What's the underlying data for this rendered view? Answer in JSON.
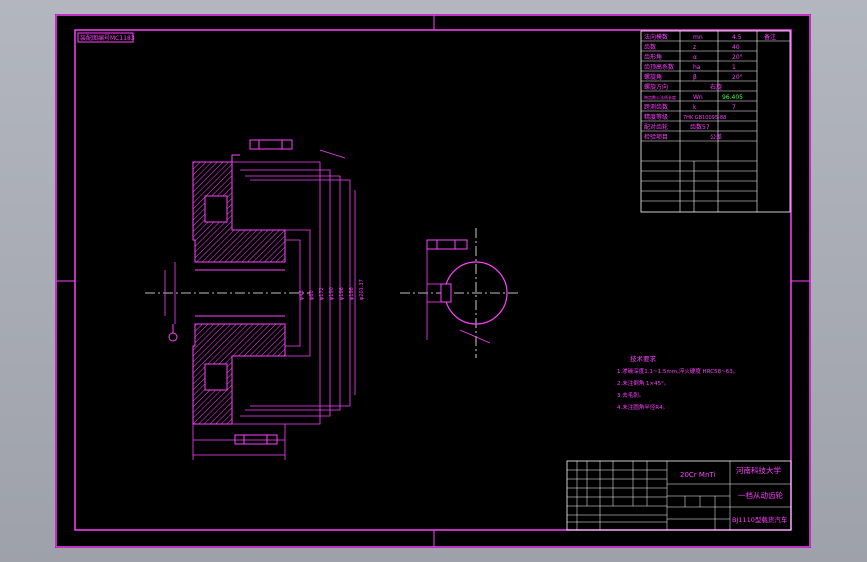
{
  "drawing": {
    "top_left_label": "装配图编号MC1183",
    "title_block": {
      "scale_code": "20Cr MnTi",
      "university": "河南科技大学",
      "part_name": "一档从动齿轮",
      "assembly_name": "BJ1110型载货汽车"
    },
    "tech_requirements": {
      "heading": "技术要求",
      "items": [
        "1.渗碳深度1.1~1.5mm,淬火硬度 HRC58~63。",
        "2.未注倒角 1×45°。",
        "3.去毛刺。",
        "4.未注圆角半径R4。"
      ]
    },
    "param_table": {
      "rows": [
        [
          "法向模数",
          "mn",
          "4.5",
          "备注"
        ],
        [
          "齿数",
          "z",
          "40",
          ""
        ],
        [
          "齿形角",
          "α",
          "20°",
          ""
        ],
        [
          "齿顶高系数",
          "ha",
          "1",
          ""
        ],
        [
          "螺旋角",
          "β",
          "20°",
          ""
        ],
        [
          "螺旋方向",
          "",
          "右旋",
          ""
        ],
        [
          "跨齿数公法线长度",
          "Wn",
          "96.405",
          ""
        ],
        [
          "跨测齿数",
          "k",
          "7",
          ""
        ],
        [
          "精度等级",
          "",
          "7HK GB10095-88",
          ""
        ],
        [
          "配对齿轮",
          "齿数57",
          "",
          ""
        ],
        [
          "检验项目",
          "",
          "公差",
          ""
        ]
      ]
    },
    "colors": {
      "line": "#ff40ff",
      "hatch": "#ff40ff",
      "center": "#ffffff",
      "accent": "#40ff40"
    }
  }
}
